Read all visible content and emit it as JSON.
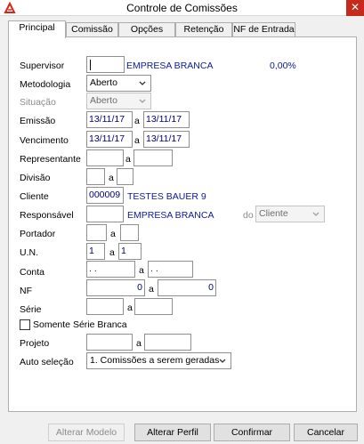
{
  "window": {
    "title": "Controle de Comissões",
    "close_glyph": "✕"
  },
  "tabs": [
    {
      "label": "Principal"
    },
    {
      "label": "Comissão"
    },
    {
      "label": "Opções"
    },
    {
      "label": "Retenção"
    },
    {
      "label": "NF de Entrada"
    }
  ],
  "form": {
    "supervisor": {
      "label": "Supervisor",
      "code": "",
      "name": "EMPRESA BRANCA",
      "percent": "0,00%"
    },
    "metodologia": {
      "label": "Metodologia",
      "value": "Aberto"
    },
    "situacao": {
      "label": "Situação",
      "value": "Aberto"
    },
    "emissao": {
      "label": "Emissão",
      "from": "13/11/17",
      "sep": "a",
      "to": "13/11/17"
    },
    "vencimento": {
      "label": "Vencimento",
      "from": "13/11/17",
      "sep": "a",
      "to": "13/11/17"
    },
    "representante": {
      "label": "Representante",
      "from": "",
      "sep": "a",
      "to": ""
    },
    "divisao": {
      "label": "Divisão",
      "from": "",
      "sep": "a",
      "to": ""
    },
    "cliente": {
      "label": "Cliente",
      "code": "000009",
      "name": "TESTES BAUER 9"
    },
    "responsavel": {
      "label": "Responsável",
      "code": "",
      "name": "EMPRESA BRANCA",
      "do_label": "do",
      "do_value": "Cliente"
    },
    "portador": {
      "label": "Portador",
      "from": "",
      "sep": "a",
      "to": ""
    },
    "un": {
      "label": "U.N.",
      "from": "1",
      "sep": "a",
      "to": "1"
    },
    "conta": {
      "label": "Conta",
      "from": " .  .",
      "sep": "a",
      "to": " .  ."
    },
    "nf": {
      "label": "NF",
      "from": "0",
      "sep": "a",
      "to": "0"
    },
    "serie": {
      "label": "Série",
      "from": "",
      "sep": "a",
      "to": ""
    },
    "somente_serie_branca": {
      "label": "Somente Série Branca",
      "checked": false
    },
    "projeto": {
      "label": "Projeto",
      "from": "",
      "sep": "a",
      "to": ""
    },
    "auto_selecao": {
      "label": "Auto seleção",
      "value": "1. Comissões a serem geradas"
    }
  },
  "buttons": {
    "alterar_modelo": "Alterar Modelo",
    "alterar_perfil": "Alterar Perfil",
    "confirmar": "Confirmar",
    "cancelar": "Cancelar"
  },
  "colors": {
    "value_text": "#0b1a9e",
    "close_button": "#c42b1c"
  },
  "icons": {
    "app": "app-logo-icon",
    "dropdown": "chevron-down-icon",
    "close": "close-icon"
  }
}
